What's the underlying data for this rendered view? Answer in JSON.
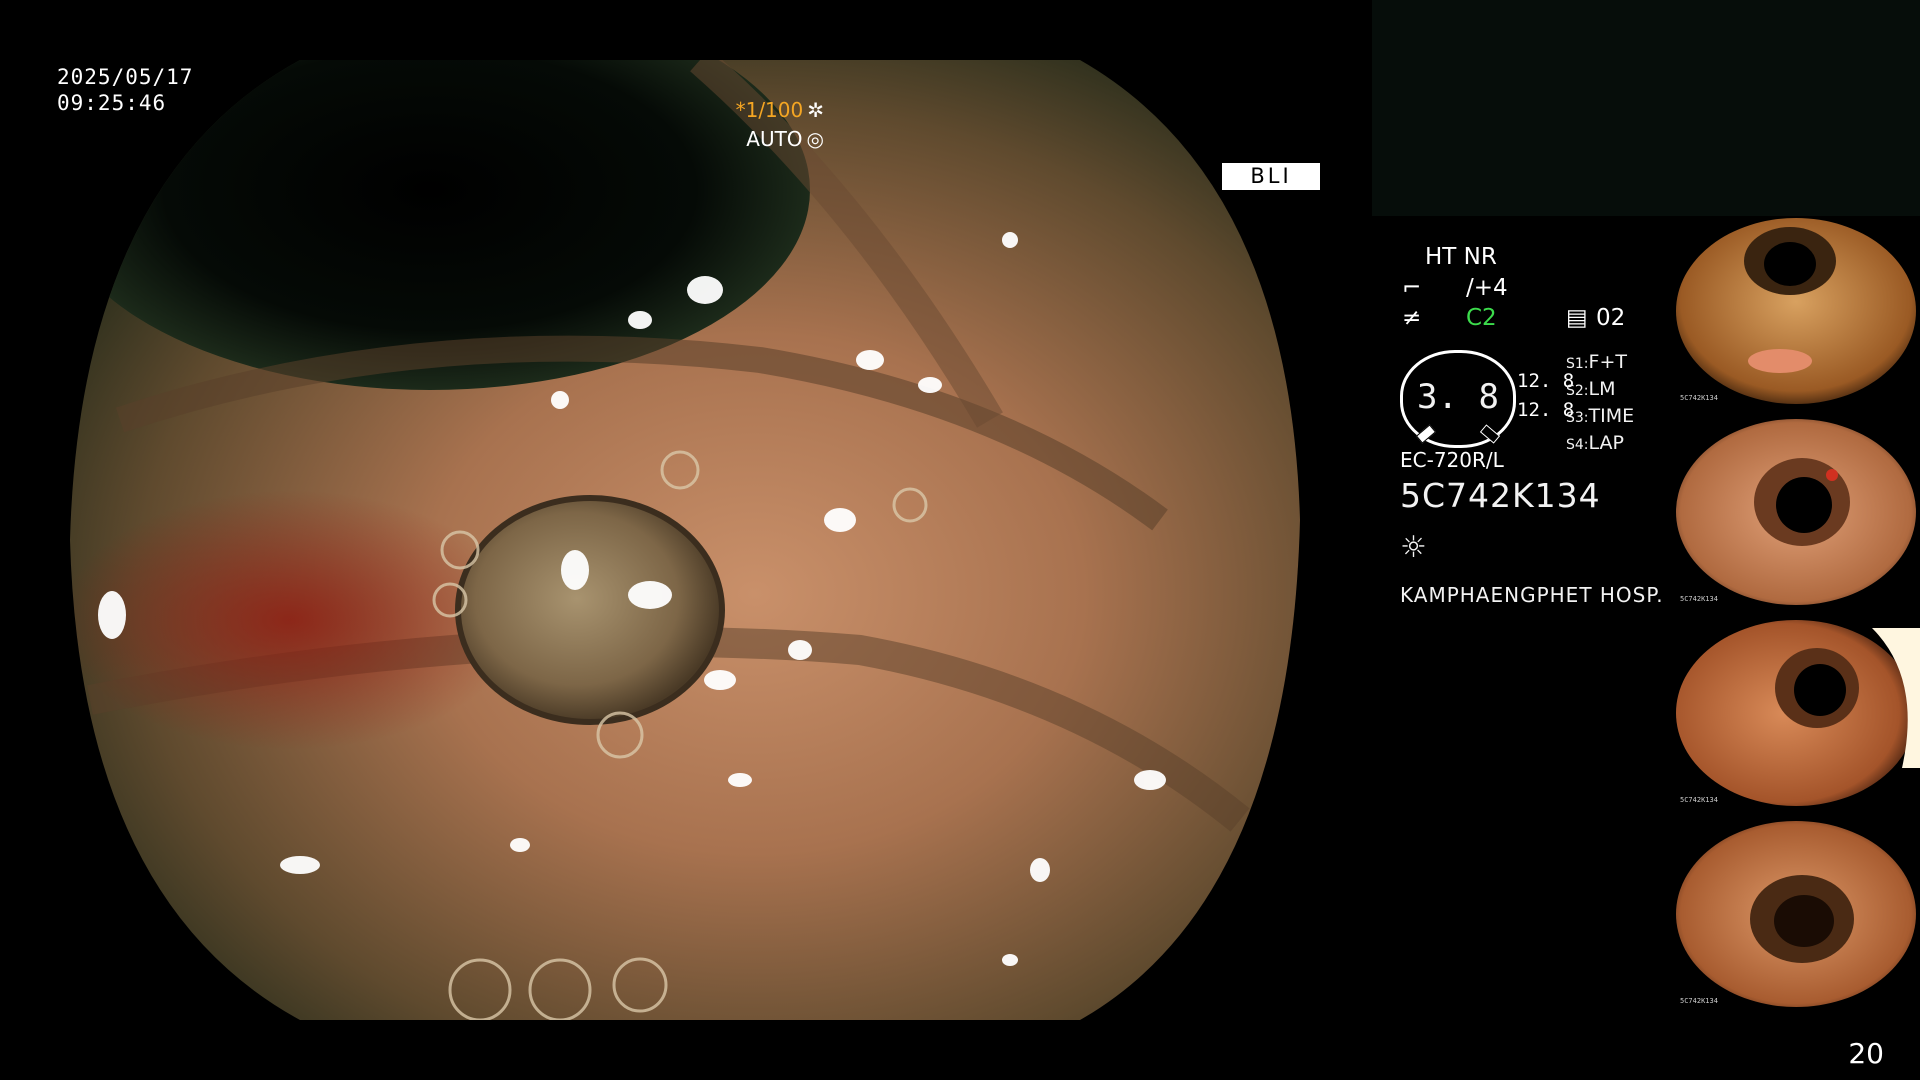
{
  "overlay": {
    "date": "2025/05/17",
    "time": "09:25:46",
    "shutter": "*1/100",
    "shutter_icon": "✲",
    "auto_mode": "AUTO",
    "auto_icon": "◎",
    "mode_badge": "BLI"
  },
  "panel": {
    "ht_nr": "HT NR",
    "enhance_value": "/+4",
    "color_value": "C2",
    "memory_value": "02",
    "gauge_value": "3. 8",
    "gauge_left_1": "12. 8",
    "gauge_left_2": "12. 8",
    "switches": [
      {
        "key": "S1:",
        "value": "F+T"
      },
      {
        "key": "S2:",
        "value": "LM"
      },
      {
        "key": "S3:",
        "value": "TIME"
      },
      {
        "key": "S4:",
        "value": "LAP"
      }
    ],
    "scope_model": "EC-720R/L",
    "serial": "5C742K134",
    "lamp_icon": "☼",
    "hospital": "KAMPHAENGPHET HOSP.",
    "accent_green": "#3cdc4c",
    "accent_orange": "#f5a623"
  },
  "thumbnails": [
    {
      "caption": "5C742K134"
    },
    {
      "caption": "5C742K134"
    },
    {
      "caption": "5C742K134"
    },
    {
      "caption": "5C742K134"
    }
  ],
  "page_number": "20"
}
